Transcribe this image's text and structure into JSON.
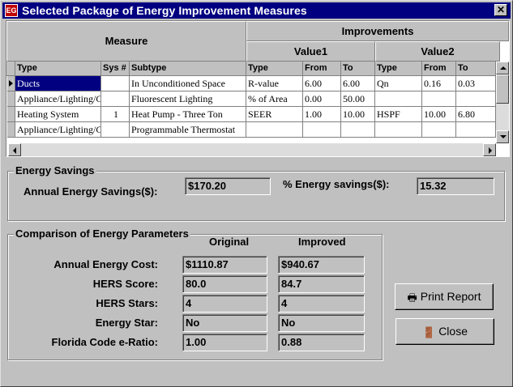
{
  "window": {
    "title": "Selected Package of Energy Improvement Measures",
    "close_glyph": "✕"
  },
  "grid": {
    "group_headers": {
      "measure": "Measure",
      "improvements": "Improvements",
      "value1": "Value1",
      "value2": "Value2"
    },
    "columns": [
      "Type",
      "Sys #",
      "Subtype",
      "Type",
      "From",
      "To",
      "Type",
      "From",
      "To"
    ],
    "rows": [
      [
        "Ducts",
        "",
        "In Unconditioned Space",
        "R-value",
        "6.00",
        "6.00",
        "Qn",
        "0.16",
        "0.03"
      ],
      [
        "Appliance/Lighting/Co",
        "",
        "Fluorescent Lighting",
        "% of Area",
        "0.00",
        "50.00",
        "",
        "",
        ""
      ],
      [
        "Heating System",
        "1",
        "Heat Pump - Three Ton",
        "SEER",
        "1.00",
        "10.00",
        "HSPF",
        "10.00",
        "6.80"
      ],
      [
        "Appliance/Lighting/Co",
        "",
        "Programmable Thermostat",
        "",
        "",
        "",
        "",
        "",
        ""
      ]
    ]
  },
  "energy_savings": {
    "title": "Energy Savings",
    "annual_label": "Annual Energy Savings($):",
    "annual_value": "$170.20",
    "percent_label": "% Energy savings($):",
    "percent_value": "15.32"
  },
  "comparison": {
    "title": "Comparison of Energy Parameters",
    "col_original": "Original",
    "col_improved": "Improved",
    "rows": [
      {
        "label": "Annual Energy Cost:",
        "original": "$1110.87",
        "improved": "$940.67"
      },
      {
        "label": "HERS Score:",
        "original": "80.0",
        "improved": "84.7"
      },
      {
        "label": "HERS Stars:",
        "original": "4",
        "improved": "4"
      },
      {
        "label": "Energy Star:",
        "original": "No",
        "improved": "No"
      },
      {
        "label": "Florida Code e-Ratio:",
        "original": "1.00",
        "improved": "0.88"
      }
    ]
  },
  "buttons": {
    "print_label": "Print Report",
    "close_label": "Close"
  },
  "colors": {
    "titlebar": "#000080",
    "selection": "#000080",
    "face": "#c0c0c0",
    "app_icon": "#c00000"
  }
}
